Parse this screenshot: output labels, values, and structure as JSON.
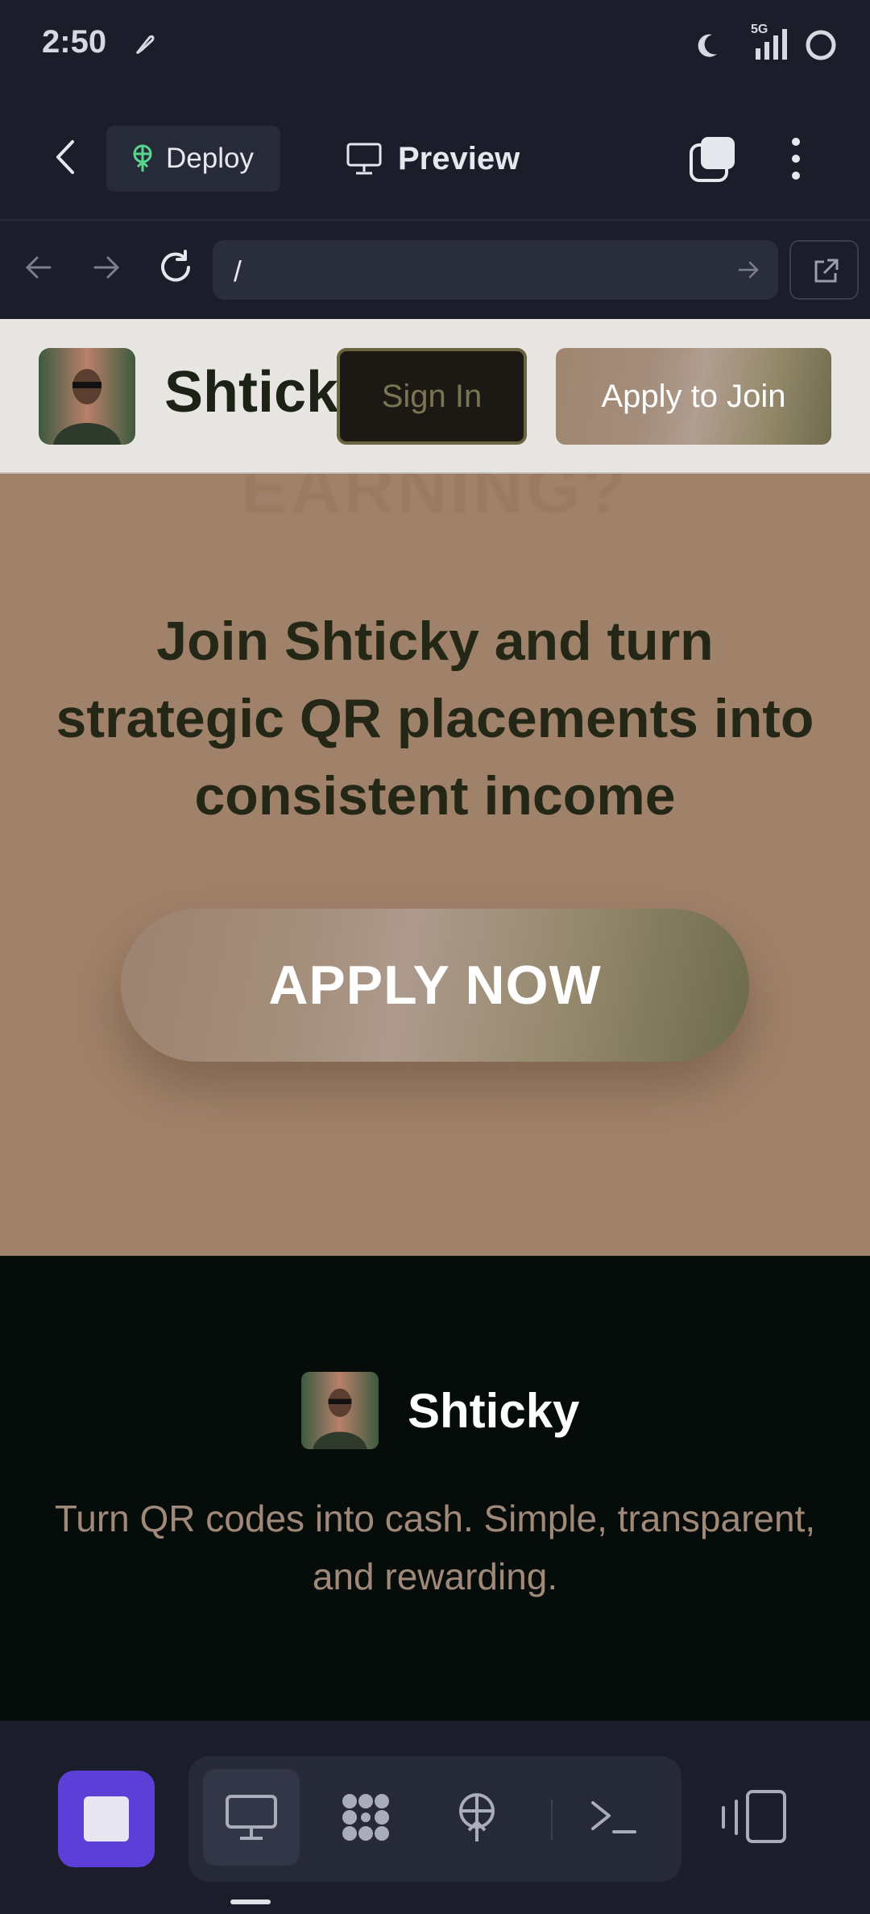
{
  "status_bar": {
    "time": "2:50",
    "network": "5G"
  },
  "toolbar": {
    "deploy_label": "Deploy",
    "preview_label": "Preview"
  },
  "browser": {
    "url": "/"
  },
  "site": {
    "brand_name": "Shticky",
    "sign_in_label": "Sign In",
    "apply_join_label": "Apply to Join",
    "hero_ghost_title": "EARNING?",
    "hero_subtitle": "Join Shticky and turn strategic QR placements into consistent income",
    "apply_now_label": "APPLY NOW",
    "footer_brand": "Shticky",
    "footer_tagline": "Turn QR codes into cash. Simple, transparent, and rewarding."
  },
  "colors": {
    "accent": "#5b3fd6",
    "header_bg": "#e8e6e3",
    "hero_bg": "#a08169",
    "footer_bg": "#050c09",
    "app_bg": "#1b1d2a"
  }
}
